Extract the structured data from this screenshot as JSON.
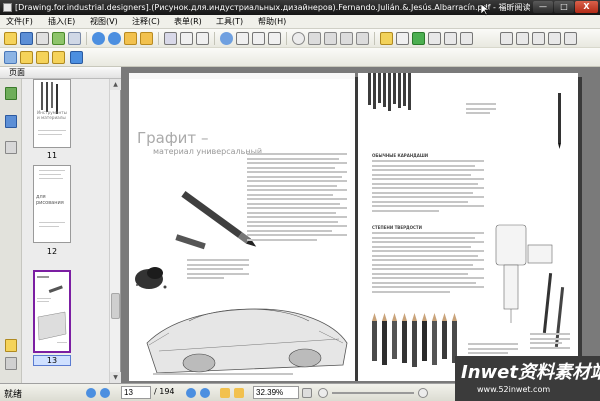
{
  "window": {
    "title": "[Drawing.for.industrial.designers].(Рисунок.для.индустриальных.дизайнеров).Fernando.Julián.&.Jesús.Albarracín.pdf - 福昕阅读器 - [(Drawing.for.industr",
    "minimize": "—",
    "maximize": "□",
    "close": "X"
  },
  "menu": {
    "items": [
      "文件(F)",
      "插入(E)",
      "视图(V)",
      "注释(C)",
      "表单(R)",
      "工具(T)",
      "帮助(H)"
    ]
  },
  "sidebar": {
    "tab_label": "页面",
    "thumbnails": [
      {
        "label": "11",
        "caption": "Инструменты и материалы"
      },
      {
        "label": "12",
        "caption": "для рисования"
      },
      {
        "label": "13",
        "caption": ""
      }
    ]
  },
  "document": {
    "left_page": {
      "title": "Графит –",
      "subtitle": "материал универсальный"
    },
    "right_page": {
      "heading1": "ОБЫЧНЫЕ КАРАНДАШИ",
      "heading2": "СТЕПЕНИ ТВЕРДОСТИ"
    }
  },
  "status": {
    "text": "就绪",
    "current_page": "13",
    "total_pages": "/ 194",
    "zoom": "32.39%"
  },
  "watermark": {
    "main": "Inwet资料素材站",
    "sub": "www.52inwet.com"
  },
  "colors": {
    "titlebar": "#1e1e1e",
    "selection": "#7b1ea2",
    "doc_background": "#7a7a7a"
  }
}
